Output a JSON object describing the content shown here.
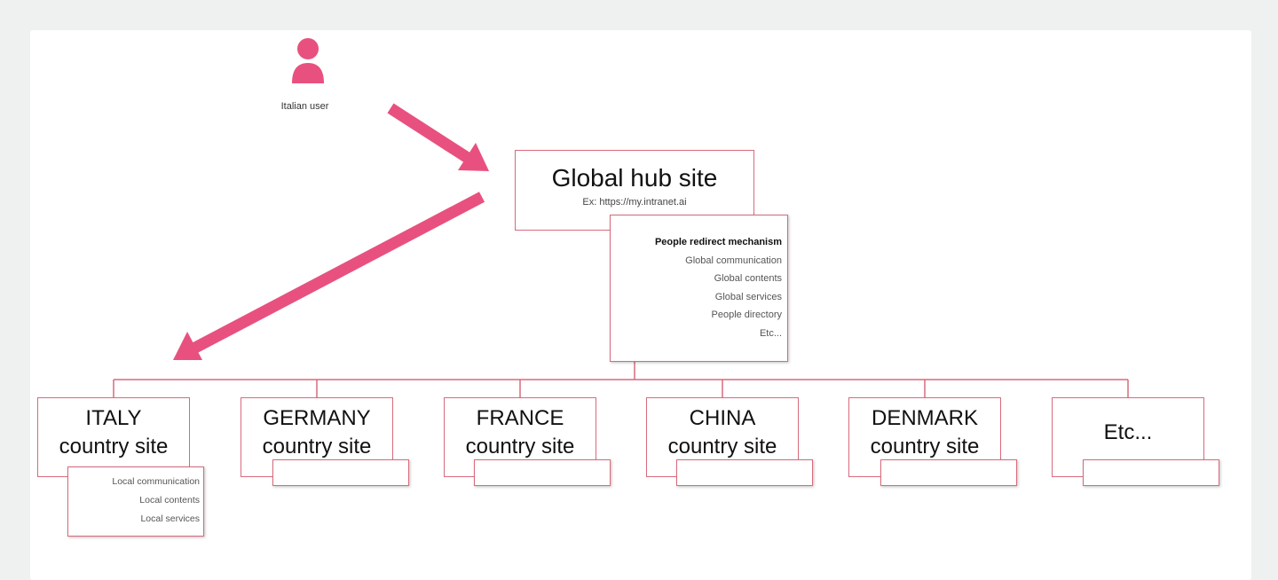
{
  "colors": {
    "accent": "#e8517f",
    "border": "#d86a7c",
    "background": "#eff0f0",
    "panel": "#ffffff"
  },
  "user": {
    "icon": "person-icon",
    "label": "Italian user"
  },
  "hub": {
    "title": "Global hub site",
    "url": "Ex: https://my.intranet.ai",
    "features": [
      "People redirect mechanism",
      "Global communication",
      "Global contents",
      "Global services",
      "People directory",
      "Etc..."
    ]
  },
  "countries": [
    {
      "name": "ITALY",
      "sub": "country site"
    },
    {
      "name": "GERMANY",
      "sub": "country site"
    },
    {
      "name": "FRANCE",
      "sub": "country site"
    },
    {
      "name": "CHINA",
      "sub": "country site"
    },
    {
      "name": "DENMARK",
      "sub": "country site"
    },
    {
      "name": "Etc...",
      "sub": ""
    }
  ],
  "italy_features": [
    "Local communication",
    "Local contents",
    "Local services"
  ]
}
